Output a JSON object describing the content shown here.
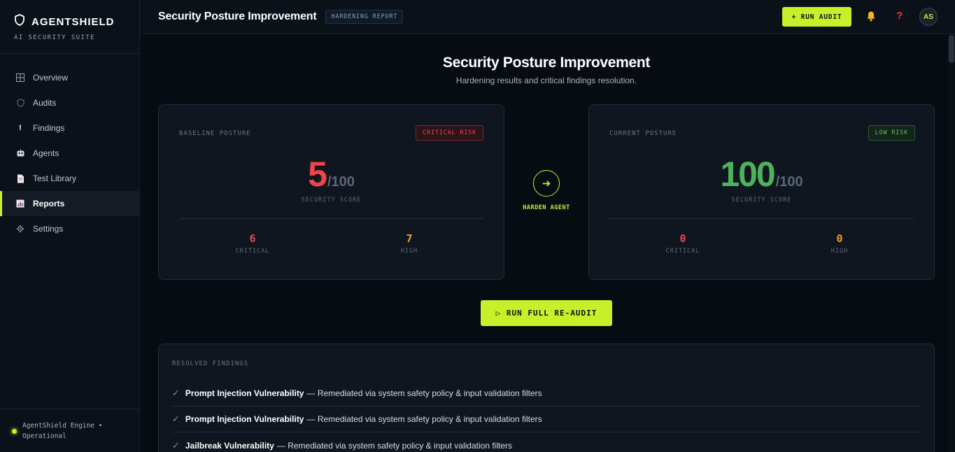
{
  "brand": {
    "name": "AGENTSHIELD",
    "subtitle": "AI SECURITY SUITE"
  },
  "sidebar": {
    "items": [
      {
        "label": "Overview",
        "icon": "grid-icon",
        "active": false
      },
      {
        "label": "Audits",
        "icon": "shield-icon",
        "active": false
      },
      {
        "label": "Findings",
        "icon": "exclamation-icon",
        "active": false
      },
      {
        "label": "Agents",
        "icon": "robot-icon",
        "active": false
      },
      {
        "label": "Test Library",
        "icon": "document-icon",
        "active": false
      },
      {
        "label": "Reports",
        "icon": "bar-chart-icon",
        "active": true
      },
      {
        "label": "Settings",
        "icon": "gear-icon",
        "active": false
      }
    ],
    "footer": {
      "line1": "AgentShield Engine •",
      "line2": "Operational"
    }
  },
  "topbar": {
    "title": "Security Posture Improvement",
    "badge": "HARDENING REPORT",
    "run_audit_label": "+ RUN AUDIT",
    "help_glyph": "?",
    "avatar_initials": "AS"
  },
  "main": {
    "title": "Security Posture Improvement",
    "subtitle": "Hardening results and critical findings resolution.",
    "baseline": {
      "label": "BASELINE POSTURE",
      "risk": "CRITICAL RISK",
      "score": "5",
      "score_of": "/100",
      "score_label": "SECURITY SCORE",
      "critical": "6",
      "critical_label": "CRITICAL",
      "high": "7",
      "high_label": "HIGH"
    },
    "current": {
      "label": "CURRENT POSTURE",
      "risk": "LOW RISK",
      "score": "100",
      "score_of": "/100",
      "score_label": "SECURITY SCORE",
      "critical": "0",
      "critical_label": "CRITICAL",
      "high": "0",
      "high_label": "HIGH"
    },
    "harden": {
      "arrow": "➔",
      "label": "HARDEN AGENT"
    },
    "reaudit_label": "▷ RUN FULL RE-AUDIT",
    "findings": {
      "label": "RESOLVED FINDINGS",
      "items": [
        {
          "name": "Prompt Injection Vulnerability",
          "detail": "— Remediated via system safety policy & input validation filters"
        },
        {
          "name": "Prompt Injection Vulnerability",
          "detail": "— Remediated via system safety policy & input validation filters"
        },
        {
          "name": "Jailbreak Vulnerability",
          "detail": "— Remediated via system safety policy & input validation filters"
        }
      ]
    }
  },
  "colors": {
    "accent": "#c8f02a",
    "critical": "#f0444a",
    "high": "#f0a022",
    "success": "#4db35a"
  }
}
